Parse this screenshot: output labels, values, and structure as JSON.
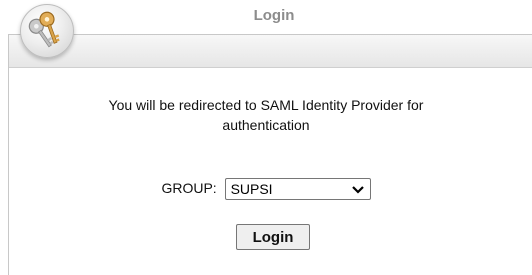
{
  "header": {
    "title": "Login"
  },
  "message": {
    "line1": "You will be redirected to SAML Identity Provider for",
    "line2": "authentication"
  },
  "group": {
    "label": "GROUP:",
    "selected": "SUPSI"
  },
  "actions": {
    "login_label": "Login"
  },
  "icons": {
    "logo": "keys-icon",
    "dropdown": "chevron-down-icon"
  },
  "colors": {
    "title_text": "#8c8c8c",
    "titlebar_bg": "#e9e9e9",
    "key_gold": "#d9a34a"
  }
}
